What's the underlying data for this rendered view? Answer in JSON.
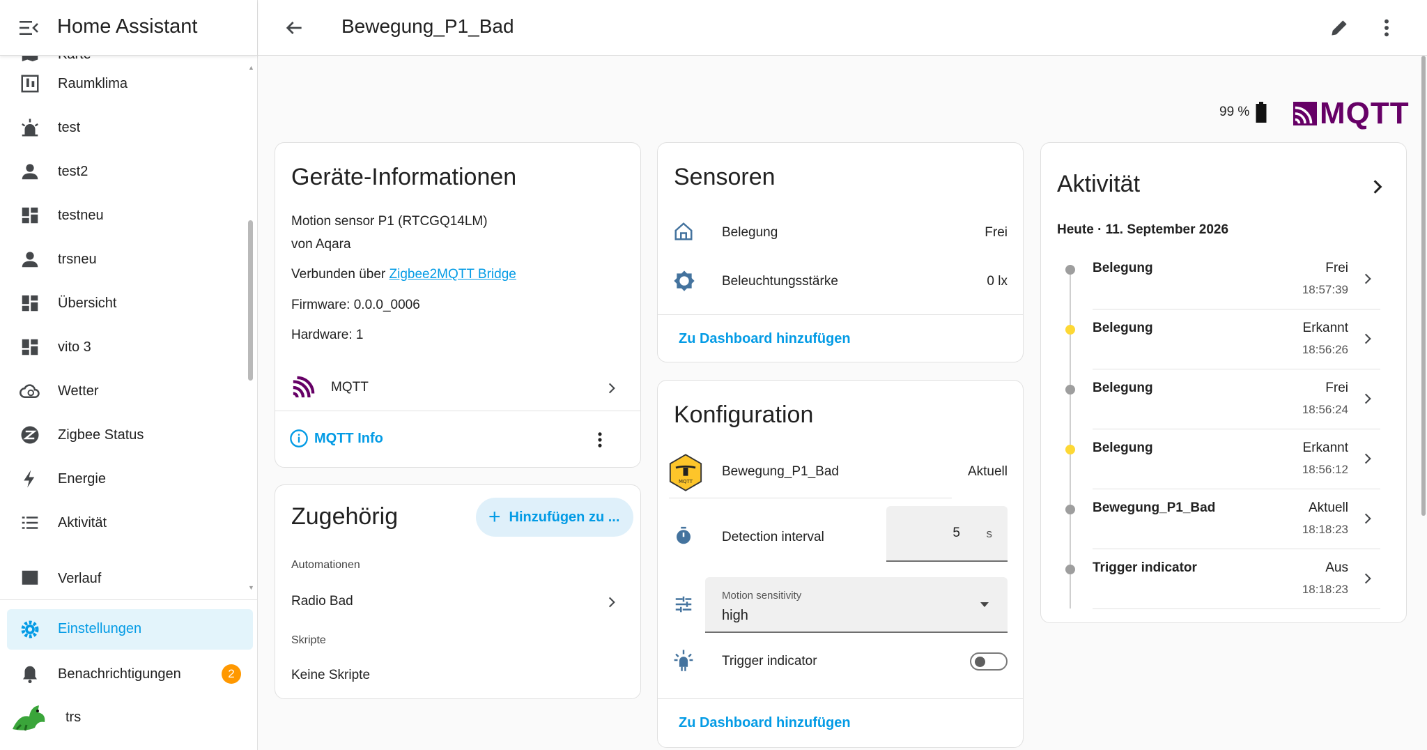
{
  "app_title": "Home Assistant",
  "page_title": "Bewegung_P1_Bad",
  "sidebar": {
    "items": [
      {
        "label": "Karte",
        "icon": "map-icon"
      },
      {
        "label": "Raumklima",
        "icon": "thermometer-icon"
      },
      {
        "label": "test",
        "icon": "alarm-light-icon"
      },
      {
        "label": "test2",
        "icon": "account-icon"
      },
      {
        "label": "testneu",
        "icon": "dashboard-icon"
      },
      {
        "label": "trsneu",
        "icon": "account-icon"
      },
      {
        "label": "Übersicht",
        "icon": "dashboard-icon"
      },
      {
        "label": "vito 3",
        "icon": "dashboard-icon"
      },
      {
        "label": "Wetter",
        "icon": "weather-icon"
      },
      {
        "label": "Zigbee Status",
        "icon": "zigbee-icon"
      },
      {
        "label": "Energie",
        "icon": "lightning-icon"
      },
      {
        "label": "Aktivität",
        "icon": "list-icon"
      },
      {
        "label": "Verlauf",
        "icon": "history-icon"
      }
    ],
    "settings_label": "Einstellungen",
    "notifications_label": "Benachrichtigungen",
    "notifications_count": "2",
    "user_label": "trs"
  },
  "header": {
    "battery": "99 %",
    "brand_logo_text": "MQTT"
  },
  "device_info": {
    "title": "Geräte-Informationen",
    "model": "Motion sensor P1 (RTCGQ14LM)",
    "manufacturer": "von Aqara",
    "connected_prefix": "Verbunden über ",
    "connected_link": "Zigbee2MQTT Bridge",
    "firmware": "Firmware: 0.0.0_0006",
    "hardware": "Hardware: 1",
    "integration": "MQTT",
    "info_link": "MQTT Info"
  },
  "related": {
    "title": "Zugehörig",
    "add_button": "Hinzufügen zu ...",
    "automations_heading": "Automationen",
    "automation_item": "Radio Bad",
    "scripts_heading": "Skripte",
    "scripts_empty": "Keine Skripte"
  },
  "sensors": {
    "title": "Sensoren",
    "rows": [
      {
        "label": "Belegung",
        "value": "Frei"
      },
      {
        "label": "Beleuchtungsstärke",
        "value": "0 lx"
      }
    ],
    "add_link": "Zu Dashboard hinzufügen"
  },
  "config": {
    "title": "Konfiguration",
    "firmware_entity": "Bewegung_P1_Bad",
    "firmware_state": "Aktuell",
    "detection_label": "Detection interval",
    "detection_value": "5",
    "detection_unit": "s",
    "sensitivity_label": "Motion sensitivity",
    "sensitivity_value": "high",
    "trigger_label": "Trigger indicator",
    "add_link": "Zu Dashboard hinzufügen"
  },
  "activity": {
    "title": "Aktivität",
    "date": "Heute · 11. September 2026",
    "entries": [
      {
        "name": "Belegung",
        "state": "Frei",
        "time": "18:57:39",
        "dot": "#9e9e9e"
      },
      {
        "name": "Belegung",
        "state": "Erkannt",
        "time": "18:56:26",
        "dot": "#fdd835"
      },
      {
        "name": "Belegung",
        "state": "Frei",
        "time": "18:56:24",
        "dot": "#9e9e9e"
      },
      {
        "name": "Belegung",
        "state": "Erkannt",
        "time": "18:56:12",
        "dot": "#fdd835"
      },
      {
        "name": "Bewegung_P1_Bad",
        "state": "Aktuell",
        "time": "18:18:23",
        "dot": "#9e9e9e"
      },
      {
        "name": "Trigger indicator",
        "state": "Aus",
        "time": "18:18:23",
        "dot": "#9e9e9e"
      }
    ]
  },
  "colors": {
    "accent": "#039be5",
    "mqtt_brand": "#660066",
    "badge": "#ff9800"
  }
}
